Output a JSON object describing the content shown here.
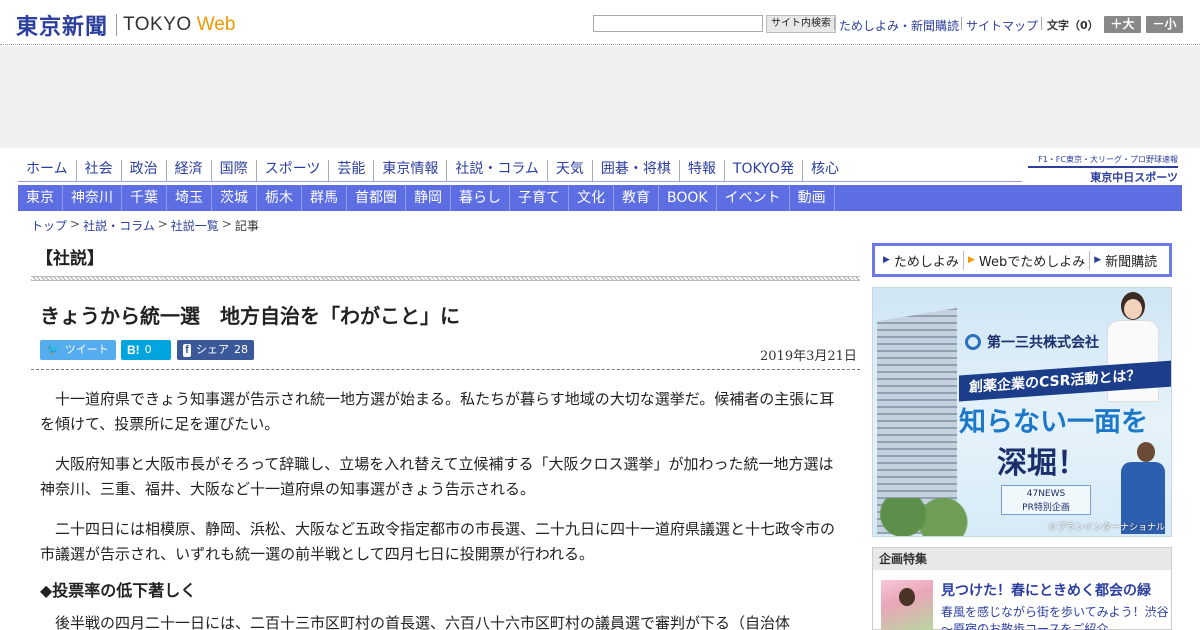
{
  "header": {
    "logo_jp": "東京新聞",
    "logo_en": "TOKYO",
    "logo_web": "Web",
    "search_placeholder": "",
    "search_button": "サイト内検索",
    "links": [
      "ためしよみ・新聞購読",
      "サイトマップ"
    ],
    "font_label": "文字（0）",
    "font_up": "＋大",
    "font_down": "－小"
  },
  "global_nav": [
    "ホーム",
    "社会",
    "政治",
    "経済",
    "国際",
    "スポーツ",
    "芸能",
    "東京情報",
    "社説・コラム",
    "天気",
    "囲碁・将棋",
    "特報",
    "TOKYO発",
    "核心"
  ],
  "chunichi": {
    "sub": "F1・FC東京・大リーグ・プロ野球速報",
    "main": "東京中日スポーツ"
  },
  "local_nav": [
    "東京",
    "神奈川",
    "千葉",
    "埼玉",
    "茨城",
    "栃木",
    "群馬",
    "首都圏",
    "静岡",
    "暮らし",
    "子育て",
    "文化",
    "教育",
    "BOOK",
    "イベント",
    "動画"
  ],
  "breadcrumb": [
    "トップ",
    "社説・コラム",
    "社説一覧",
    "記事"
  ],
  "article": {
    "section": "【社説】",
    "title": "きょうから統一選　地方自治を「わがこと」に",
    "date": "2019年3月21日",
    "share": {
      "tweet_icon": "🐦",
      "tweet_label": "ツイート",
      "hatena_icon": "B!",
      "hatena_count": "0",
      "facebook_icon": "f",
      "facebook_label": "シェア",
      "facebook_count": "28"
    },
    "paragraphs": [
      "十一道府県できょう知事選が告示され統一地方選が始まる。私たちが暮らす地域の大切な選挙だ。候補者の主張に耳を傾けて、投票所に足を運びたい。",
      "大阪府知事と大阪市長がそろって辞職し、立場を入れ替えて立候補する「大阪クロス選挙」が加わった統一地方選は神奈川、三重、福井、大阪など十一道府県の知事選がきょう告示される。",
      "二十四日には相模原、静岡、浜松、大阪など五政令指定都市の市長選、二十九日に四十一道府県議選と十七政令市の市議選が告示され、いずれも統一選の前半戦として四月七日に投開票が行われる。"
    ],
    "subheading": "◆投票率の低下著しく",
    "paragraph_after": "後半戦の四月二十一日には、二百十三市区町村の首長選、六百八十六市区町村の議員選で審判が下る（自治体"
  },
  "sidebar": {
    "subscribe": [
      "ためしよみ",
      "Webでためしよみ",
      "新聞購読"
    ],
    "ad": {
      "company": "第一三共株式会社",
      "band": "創薬企業のCSR活動とは？",
      "big1": "知らない一面を",
      "big2": "深堀！",
      "news_line1": "47NEWS",
      "news_line2": "PR特別企画",
      "credit": "©プランインターナショナル"
    },
    "kikaku": {
      "head": "企画特集",
      "title": "見つけた！春にときめく都会の緑",
      "desc": "春風を感じながら街を歩いてみよう！渋谷～原宿のお散歩コースをご紹介"
    }
  }
}
